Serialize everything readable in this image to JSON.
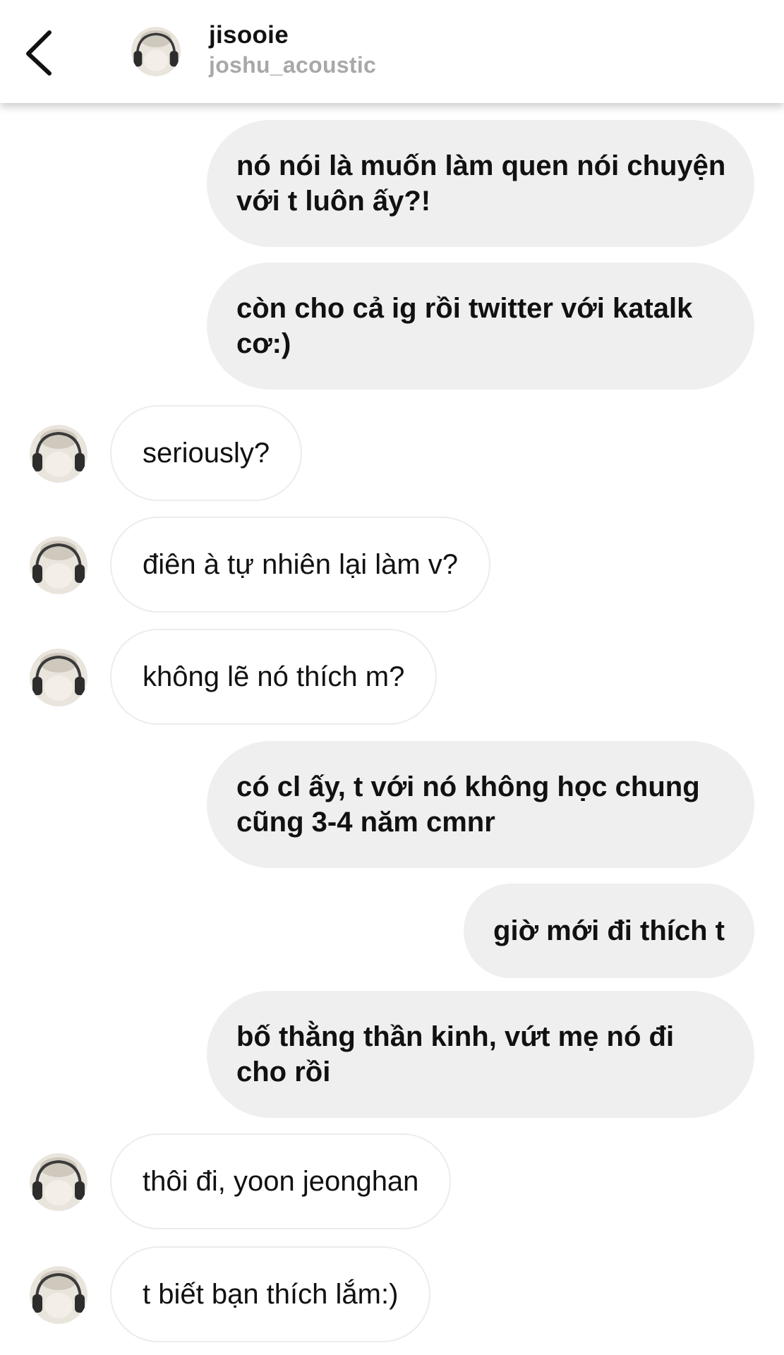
{
  "header": {
    "name": "jisooie",
    "username": "joshu_acoustic",
    "back_icon": "chevron-left-icon",
    "avatar_icon": "avatar-image"
  },
  "messages": [
    {
      "from": "me",
      "text": "nó nói là muốn làm quen nói chuyện với t luôn ấy?!"
    },
    {
      "from": "me",
      "text": "còn cho cả ig rồi twitter với katalk cơ:)"
    },
    {
      "from": "them",
      "text": "seriously?"
    },
    {
      "from": "them",
      "text": "điên à tự nhiên lại làm v?"
    },
    {
      "from": "them",
      "text": "không lẽ nó thích m?"
    },
    {
      "from": "me",
      "text": "có cl ấy, t với nó không học chung cũng 3-4 năm cmnr"
    },
    {
      "from": "me",
      "text": "giờ mới đi thích t"
    },
    {
      "from": "me",
      "text": "bố thằng thần kinh, vứt mẹ nó đi cho rồi"
    },
    {
      "from": "them",
      "text": "thôi đi, yoon jeonghan"
    },
    {
      "from": "them",
      "text": "t biết bạn thích lắm:)"
    }
  ],
  "colors": {
    "sent_bubble": "#efefef",
    "received_border": "#ececec",
    "username_gray": "#a8a8a8"
  }
}
